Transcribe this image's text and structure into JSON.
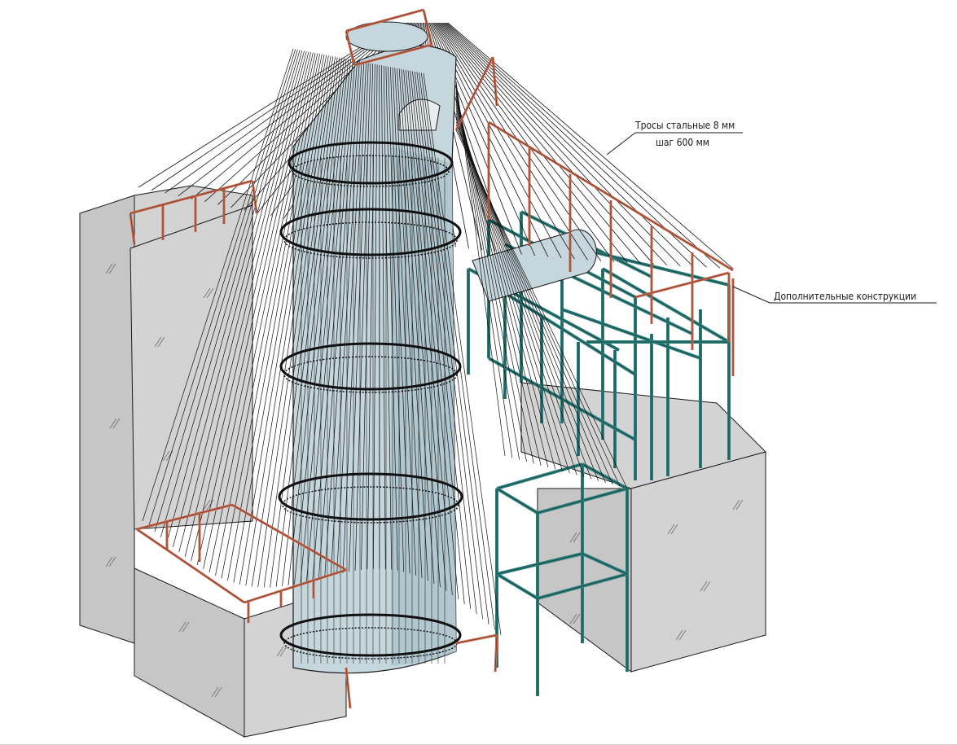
{
  "callouts": {
    "cables_line1": "Тросы стальные 8 мм",
    "cables_line2": "шаг 600 мм",
    "extra_structures": "Дополнительные конструкции"
  },
  "colors": {
    "block_fill": "#d3d3d3",
    "block_side": "#c6c6c6",
    "tower_fill": "#c5d7dd",
    "tower_shade": "#b2c8d0",
    "steel_frame": "#2f7f7c",
    "rail": "#c96a4f",
    "cable": "#111111",
    "outline": "#1a1a1a"
  }
}
